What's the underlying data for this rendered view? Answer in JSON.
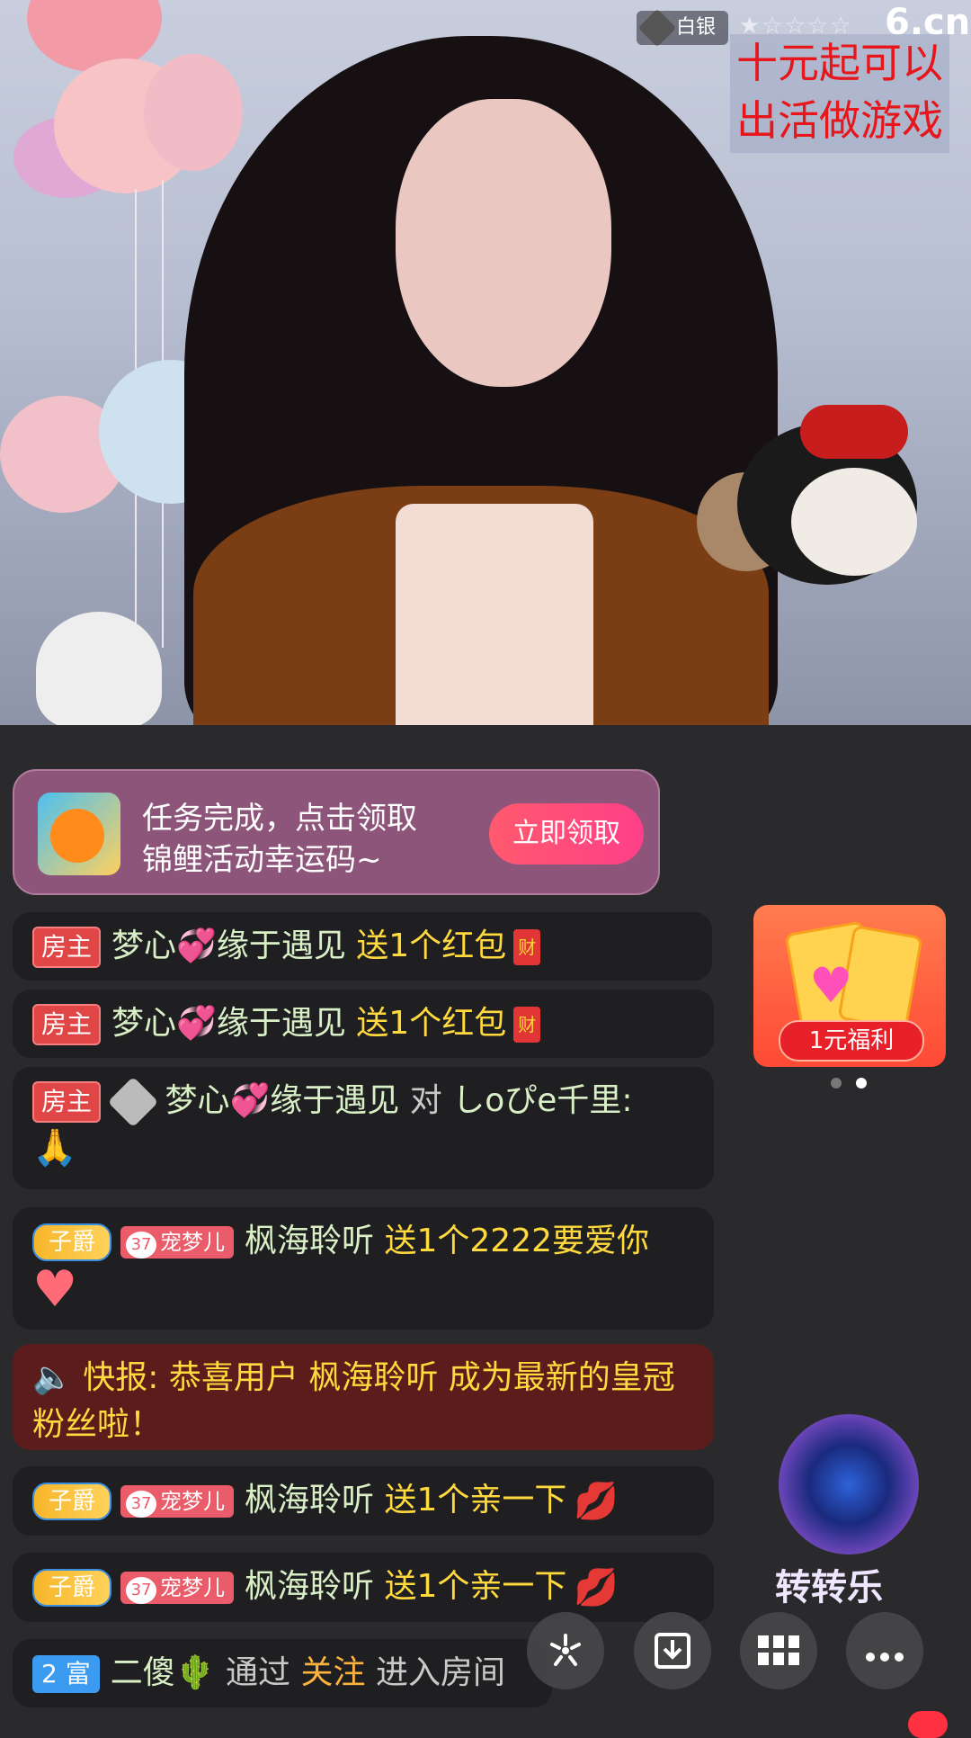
{
  "stream": {
    "level_badge": "白银",
    "stars": "★☆☆☆☆",
    "site_logo": "6.cn",
    "overlay_note_line1": "十元起可以",
    "overlay_note_line2": "出活做游戏"
  },
  "task_card": {
    "line1": "任务完成，点击领取",
    "line2": "锦鲤活动幸运码~",
    "claim_label": "立即领取"
  },
  "chat": [
    {
      "tag": "房主",
      "user": "梦心💞缘于遇见",
      "action": "送1个红包",
      "icon": "财"
    },
    {
      "tag": "房主",
      "user": "梦心💞缘于遇见",
      "action": "送1个红包",
      "icon": "财"
    },
    {
      "tag": "房主",
      "user": "梦心💞缘于遇见",
      "connector": "对",
      "target": "しoぴe千里:",
      "emoji": "🙏"
    },
    {
      "tag": "子爵",
      "fan_level": "37",
      "fan_tag": "宠梦儿",
      "user": "枫海聆听",
      "action": "送1个2222要爱你",
      "emoji": "♥"
    },
    {
      "news_label": "快报:",
      "news_text": "恭喜用户 枫海聆听 成为最新的皇冠粉丝啦！"
    },
    {
      "tag": "子爵",
      "fan_level": "37",
      "fan_tag": "宠梦儿",
      "user": "枫海聆听",
      "action": "送1个亲一下",
      "emoji": "💋"
    },
    {
      "tag": "子爵",
      "fan_level": "37",
      "fan_tag": "宠梦儿",
      "user": "枫海聆听",
      "action": "送1个亲一下",
      "emoji": "💋"
    },
    {
      "rich_level": "2",
      "rich_tag": "富",
      "user": "二傻🌵",
      "pre": "通过",
      "via": "关注",
      "post": "进入房间"
    }
  ],
  "widgets": {
    "welfare_label": "1元福利",
    "wheel_label": "转转乐"
  },
  "colors": {
    "accent": "#ff3f88",
    "gift_text": "#ffd93d",
    "username_text": "#d9f0c7"
  },
  "icons": {
    "share": "share-icon",
    "download": "download-icon",
    "grid": "grid-icon",
    "more": "more-icon"
  }
}
